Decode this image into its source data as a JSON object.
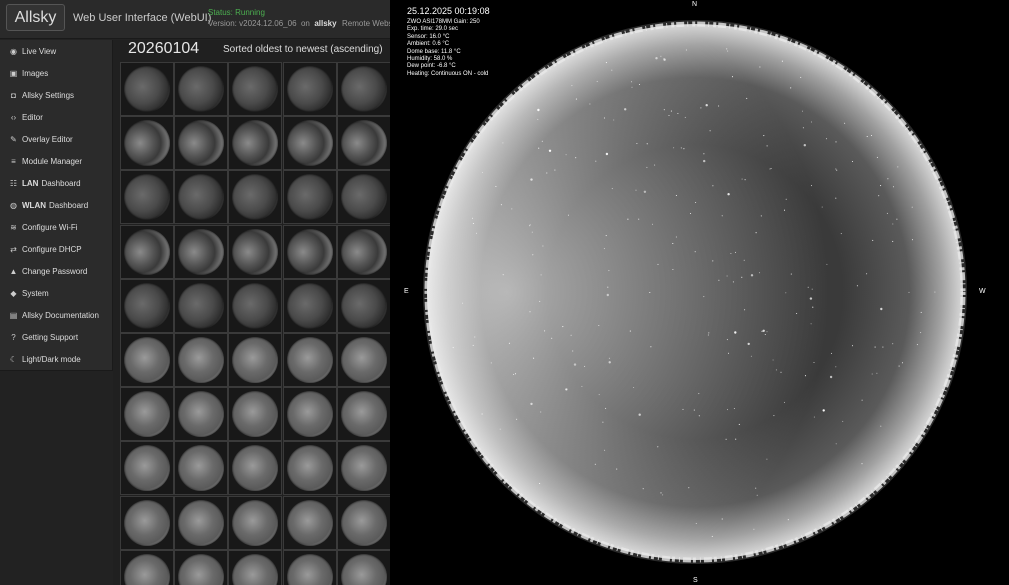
{
  "header": {
    "brand": "Allsky",
    "subtitle": "Web User Interface (WebUI)",
    "status": "Status: Running",
    "version_prefix": "Version: v2024.12.06_06",
    "version_on": "on",
    "host": "allsky",
    "remote": "Remote Webs"
  },
  "sidebar": {
    "items": [
      {
        "icon": "eye-icon",
        "glyph": "◉",
        "bold": "",
        "label": "Live View"
      },
      {
        "icon": "images-icon",
        "glyph": "▣",
        "bold": "",
        "label": "Images"
      },
      {
        "icon": "camera-icon",
        "glyph": "◘",
        "bold": "",
        "label": "Allsky Settings"
      },
      {
        "icon": "code-icon",
        "glyph": "‹›",
        "bold": "",
        "label": "Editor"
      },
      {
        "icon": "edit-icon",
        "glyph": "✎",
        "bold": "",
        "label": "Overlay Editor"
      },
      {
        "icon": "list-icon",
        "glyph": "≡",
        "bold": "",
        "label": "Module Manager"
      },
      {
        "icon": "network-icon",
        "glyph": "☷",
        "bold": "LAN",
        "label": "Dashboard"
      },
      {
        "icon": "globe-icon",
        "glyph": "◍",
        "bold": "WLAN",
        "label": "Dashboard"
      },
      {
        "icon": "wifi-icon",
        "glyph": "≋",
        "bold": "",
        "label": "Configure Wi-Fi"
      },
      {
        "icon": "exchange-icon",
        "glyph": "⇄",
        "bold": "",
        "label": "Configure DHCP"
      },
      {
        "icon": "lock-icon",
        "glyph": "▲",
        "bold": "",
        "label": "Change Password"
      },
      {
        "icon": "cube-icon",
        "glyph": "◆",
        "bold": "",
        "label": "System"
      },
      {
        "icon": "book-icon",
        "glyph": "▤",
        "bold": "",
        "label": "Allsky Documentation"
      },
      {
        "icon": "question-icon",
        "glyph": "?",
        "bold": "",
        "label": "Getting Support"
      },
      {
        "icon": "moon-icon",
        "glyph": "☾",
        "bold": "",
        "label": "Light/Dark mode"
      }
    ]
  },
  "gallery": {
    "date": "20260104",
    "sort_label": "Sorted oldest to newest (ascending)",
    "columns": 5,
    "rows": 10
  },
  "sky": {
    "datetime": "25.12.2025  00:19:08",
    "overlay_lines": [
      "ZWO ASI178MM    Gain: 250",
      "Exp. time: 29.0 sec",
      "Sensor: 16.0 °C",
      "Ambient: 0.6 °C",
      "Dome base: 11.8 °C",
      "Humidity: 58.0 %",
      "Dew point: -6.8 °C",
      "Heating: Continuous ON - cold"
    ],
    "compass": {
      "north": "N",
      "south": "S",
      "east": "E",
      "west": "W"
    }
  }
}
